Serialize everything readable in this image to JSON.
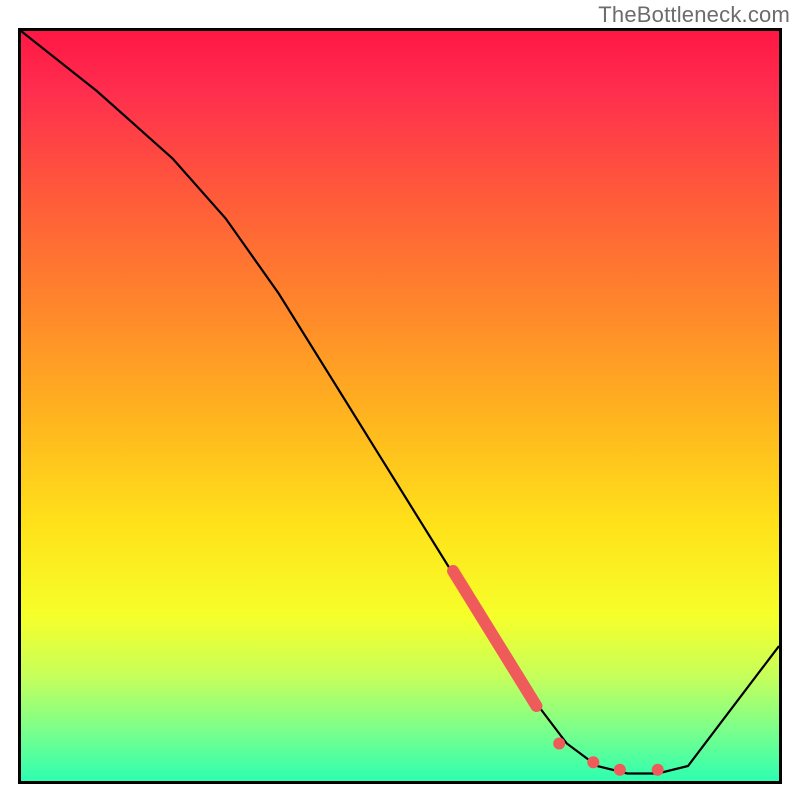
{
  "attribution": "TheBottleneck.com",
  "chart_data": {
    "type": "line",
    "title": "",
    "xlabel": "",
    "ylabel": "",
    "xlim": [
      0,
      100
    ],
    "ylim": [
      0,
      100
    ],
    "axes_visible": false,
    "grid": false,
    "background": "vertical-gradient red→yellow→green",
    "series": [
      {
        "name": "curve",
        "x": [
          0,
          10,
          20,
          27,
          34,
          42,
          50,
          58,
          66,
          72,
          76,
          80,
          84,
          88,
          100
        ],
        "y": [
          100,
          92,
          83,
          75,
          65,
          52,
          39,
          26,
          13,
          5,
          2,
          1,
          1,
          2,
          18
        ],
        "color": "#000000",
        "stroke_width": 2
      }
    ],
    "markers": [
      {
        "name": "thick-segment",
        "shape": "line-segment",
        "color": "#ef5b5b",
        "stroke_width": 12,
        "x": [
          57,
          68
        ],
        "y": [
          28,
          10
        ]
      },
      {
        "name": "dot-1",
        "shape": "circle",
        "color": "#ef5b5b",
        "r": 6,
        "x": 71,
        "y": 5
      },
      {
        "name": "dot-2",
        "shape": "circle",
        "color": "#ef5b5b",
        "r": 6,
        "x": 75.5,
        "y": 2.5
      },
      {
        "name": "dot-3",
        "shape": "circle",
        "color": "#ef5b5b",
        "r": 6,
        "x": 79,
        "y": 1.5
      },
      {
        "name": "dot-4",
        "shape": "circle",
        "color": "#ef5b5b",
        "r": 6,
        "x": 84,
        "y": 1.5
      }
    ]
  }
}
